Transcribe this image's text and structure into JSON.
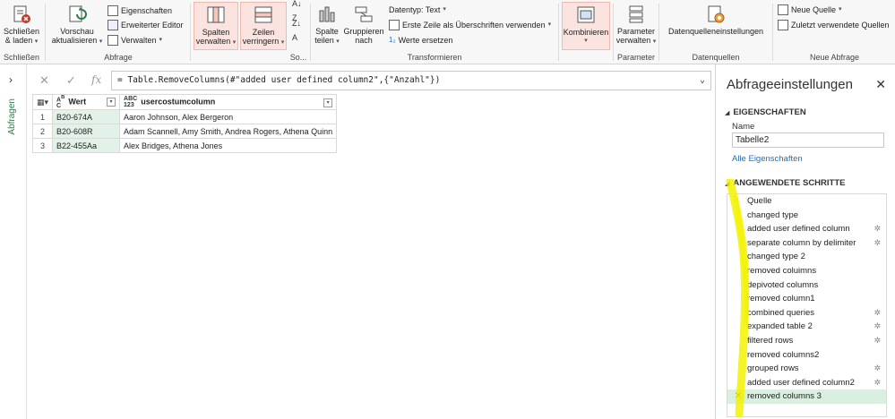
{
  "ribbon": {
    "groups": {
      "schliessen": "Schließen",
      "abfrage": "Abfrage",
      "so": "So...",
      "transformieren": "Transformieren",
      "parameter": "Parameter",
      "datenquellen": "Datenquellen",
      "neue_abfrage": "Neue Abfrage"
    },
    "close_load": [
      "Schließen",
      "& laden"
    ],
    "preview_refresh": [
      "Vorschau",
      "aktualisieren"
    ],
    "properties": "Eigenschaften",
    "advanced_editor": "Erweiterter Editor",
    "manage": "Verwalten",
    "manage_columns": [
      "Spalten",
      "verwalten"
    ],
    "reduce_rows": [
      "Zeilen",
      "verringern"
    ],
    "split_column": [
      "Spalte",
      "teilen"
    ],
    "group_by": [
      "Gruppieren",
      "nach"
    ],
    "data_type": "Datentyp: Text",
    "first_row_headers": "Erste Zeile als Überschriften verwenden",
    "replace_values": "Werte ersetzen",
    "combine": "Kombinieren",
    "manage_parameters": [
      "Parameter",
      "verwalten"
    ],
    "data_source_settings": "Datenquelleneinstellungen",
    "new_source": "Neue Quelle",
    "recent_sources": "Zuletzt verwendete Quellen"
  },
  "leftnav": {
    "label": "Abfragen"
  },
  "formula": "= Table.RemoveColumns(#\"added user defined column2\",{\"Anzahl\"})",
  "table": {
    "headers": [
      "Wert",
      "usercostumcolumn"
    ],
    "rows": [
      [
        "1",
        "B20-674A",
        "Aaron Johnson, Alex Bergeron"
      ],
      [
        "2",
        "B20-608R",
        "Adam Scannell, Amy Smith, Andrea Rogers, Athena Quinn"
      ],
      [
        "3",
        "B22-455Aa",
        "Alex Bridges, Athena Jones"
      ]
    ]
  },
  "pane": {
    "title": "Abfrageeinstellungen",
    "properties_header": "EIGENSCHAFTEN",
    "name_label": "Name",
    "name_value": "Tabelle2",
    "all_properties": "Alle Eigenschaften",
    "steps_header": "ANGEWENDETE SCHRITTE",
    "steps": [
      {
        "label": "Quelle",
        "gear": false
      },
      {
        "label": "changed type",
        "gear": false
      },
      {
        "label": "added user defined column",
        "gear": true
      },
      {
        "label": "separate column by delimiter",
        "gear": true
      },
      {
        "label": "changed type 2",
        "gear": false
      },
      {
        "label": "removed coluimns",
        "gear": false
      },
      {
        "label": "depivoted columns",
        "gear": false
      },
      {
        "label": "removed column1",
        "gear": false
      },
      {
        "label": "combined queries",
        "gear": true
      },
      {
        "label": "expanded table 2",
        "gear": true
      },
      {
        "label": "filtered rows",
        "gear": true
      },
      {
        "label": "removed columns2",
        "gear": false
      },
      {
        "label": "grouped rows",
        "gear": true
      },
      {
        "label": "added user defined column2",
        "gear": true
      },
      {
        "label": "removed columns 3",
        "gear": false
      }
    ]
  },
  "colors": {
    "accent_green": "#2d7d46",
    "highlight": "#f2f200",
    "selected_step": "#d9efe0"
  }
}
